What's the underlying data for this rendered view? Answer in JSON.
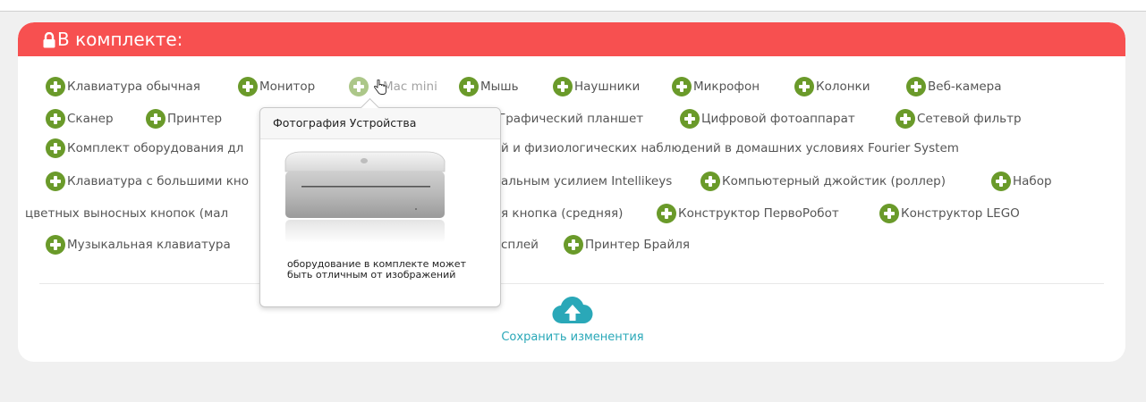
{
  "card": {
    "title": "В комплекте:",
    "header_color": "#f75050"
  },
  "items": [
    {
      "label": "Клавиатура обычная"
    },
    {
      "label": "Монитор"
    },
    {
      "label": "Mac mini"
    },
    {
      "label": "Мышь"
    },
    {
      "label": "Наушники"
    },
    {
      "label": "Микрофон"
    },
    {
      "label": "Колонки"
    },
    {
      "label": "Веб-камера"
    },
    {
      "label": "Сканер"
    },
    {
      "label": "Принтер"
    },
    {
      "label": "Графический планшет"
    },
    {
      "label": "Цифровой фотоаппарат"
    },
    {
      "label": "Сетевой фильтр"
    },
    {
      "label": "Комплект оборудования дл"
    },
    {
      "label": "Клавиатура с большими кно"
    },
    {
      "label": "Компьютерный джойстик (роллер)"
    },
    {
      "label": "Набор"
    },
    {
      "label": "Конструктор ПервоРобот"
    },
    {
      "label": "Конструктор LEGO"
    },
    {
      "label": "Музыкальная клавиатура"
    },
    {
      "label": "Принтер Брайля"
    }
  ],
  "fragments": {
    "row3_tail": "й и физиологических наблюдений в домашних условиях Fourier System",
    "row4_tail": "альным усилием Intellikeys",
    "row5_head": "цветных выносных кнопок (мал",
    "row5_mid": "я кнопка (средняя)",
    "row6_mid": "сплей"
  },
  "popover": {
    "title": "Фотография Устройства",
    "note": "оборудование в комплекте может быть отличным от изображений"
  },
  "save": {
    "label": "Сохранить изменентия",
    "color": "#2aa8b8"
  },
  "icons": {
    "add": "plus-circle-icon",
    "lock": "lock-icon",
    "save": "cloud-upload-icon",
    "cursor": "hand-cursor-icon"
  },
  "colors": {
    "add_icon": "#6a9a2a",
    "background": "#f0f0f0"
  }
}
